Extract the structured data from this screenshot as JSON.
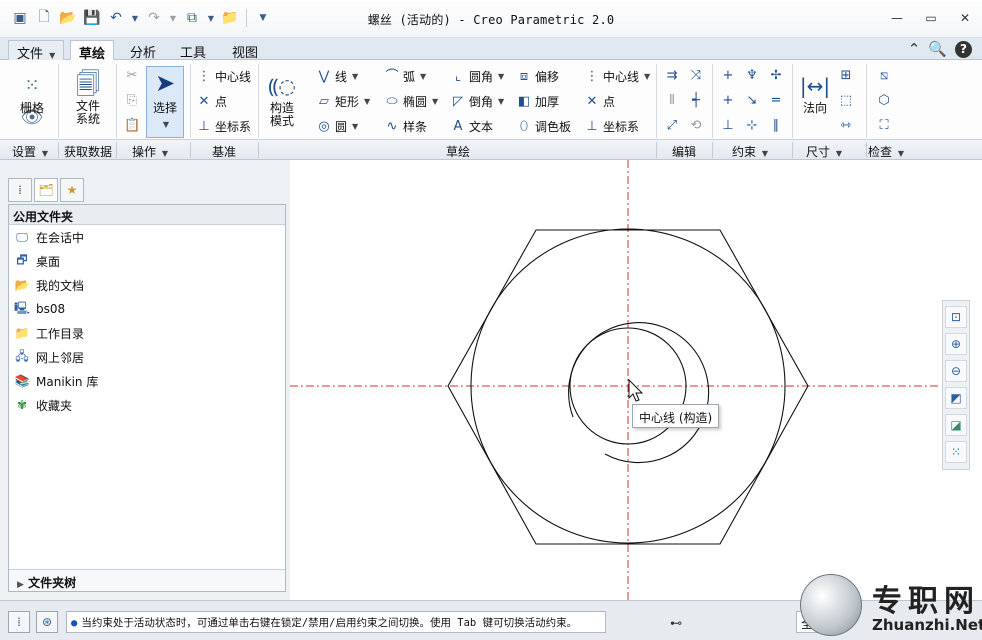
{
  "app": {
    "title": "螺丝 (活动的) - Creo Parametric 2.0"
  },
  "menu": {
    "tabs": [
      "文件",
      "草绘",
      "分析",
      "工具",
      "视图"
    ],
    "active": "草绘"
  },
  "ribbon": {
    "grid": "栅格",
    "filesystem": [
      "文件",
      "系统"
    ],
    "select": "选择",
    "centerline": "中心线",
    "point": "点",
    "csys": "坐标系",
    "construction": [
      "构造",
      "模式"
    ],
    "line": "线",
    "rectangle": "矩形",
    "circle": "圆",
    "arc": "弧",
    "ellipse": "椭圆",
    "spline": "样条",
    "fillet": "圆角",
    "chamfer": "倒角",
    "text": "文本",
    "offset": "偏移",
    "thicken": "加厚",
    "palette": "调色板",
    "centerline2": "中心线",
    "point2": "点",
    "csys2": "坐标系",
    "normal": "法向"
  },
  "groups": {
    "settings": "设置",
    "getdata": "获取数据",
    "operations": "操作",
    "datum": "基准",
    "sketch": "草绘",
    "edit": "编辑",
    "constrain": "约束",
    "dimension": "尺寸",
    "inspect": "检查"
  },
  "navigator": {
    "header": "公用文件夹",
    "items": [
      {
        "label": "在会话中",
        "icon": "monitor-icon"
      },
      {
        "label": "桌面",
        "icon": "desktop-icon"
      },
      {
        "label": "我的文档",
        "icon": "folder-open-icon"
      },
      {
        "label": "bs08",
        "icon": "computer-icon"
      },
      {
        "label": "工作目录",
        "icon": "folder-star-icon"
      },
      {
        "label": "网上邻居",
        "icon": "network-icon"
      },
      {
        "label": "Manikin 库",
        "icon": "library-icon"
      },
      {
        "label": "收藏夹",
        "icon": "favorites-icon"
      }
    ],
    "footer": "文件夹树"
  },
  "canvas": {
    "tooltip": "中心线 (构造)"
  },
  "status": {
    "message": "当约束处于活动状态时，可通过单击右键在锁定/禁用/启用约束之间切换。使用 Tab 键可切换活动约束。",
    "all_value": "全"
  },
  "watermark": {
    "title": "专职网",
    "subtitle": "Zhuanzhi.Net"
  },
  "colors": {
    "centerline": "#d0312d",
    "geometry": "#111111",
    "select_bg": "#dbe8f7"
  }
}
